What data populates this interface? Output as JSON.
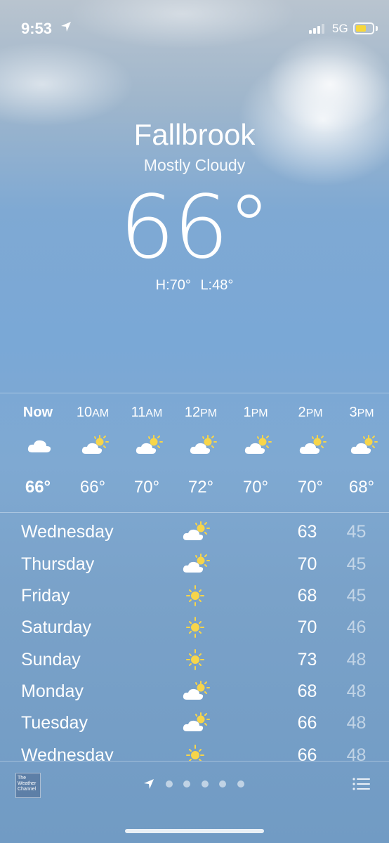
{
  "status_bar": {
    "time": "9:53",
    "network": "5G",
    "battery_color": "#f7d73b"
  },
  "location": {
    "city": "Fallbrook",
    "condition": "Mostly Cloudy",
    "temperature": "66°",
    "high": "H:70°",
    "low": "L:48°"
  },
  "hourly": [
    {
      "label": "Now",
      "icon": "cloud-icon",
      "temp": "66°"
    },
    {
      "label": "10AM",
      "icon": "partly-sunny-icon",
      "temp": "66°"
    },
    {
      "label": "11AM",
      "icon": "partly-sunny-icon",
      "temp": "70°"
    },
    {
      "label": "12PM",
      "icon": "partly-sunny-icon",
      "temp": "72°"
    },
    {
      "label": "1PM",
      "icon": "partly-sunny-icon",
      "temp": "70°"
    },
    {
      "label": "2PM",
      "icon": "partly-sunny-icon",
      "temp": "70°"
    },
    {
      "label": "3PM",
      "icon": "partly-sunny-icon",
      "temp": "68°"
    }
  ],
  "daily": [
    {
      "day": "Wednesday",
      "icon": "partly-sunny-icon",
      "high": "63",
      "low": "45"
    },
    {
      "day": "Thursday",
      "icon": "partly-sunny-icon",
      "high": "70",
      "low": "45"
    },
    {
      "day": "Friday",
      "icon": "sun-icon",
      "high": "68",
      "low": "45"
    },
    {
      "day": "Saturday",
      "icon": "sun-icon",
      "high": "70",
      "low": "46"
    },
    {
      "day": "Sunday",
      "icon": "sun-icon",
      "high": "73",
      "low": "48"
    },
    {
      "day": "Monday",
      "icon": "partly-sunny-icon",
      "high": "68",
      "low": "48"
    },
    {
      "day": "Tuesday",
      "icon": "partly-sunny-icon",
      "high": "66",
      "low": "48"
    },
    {
      "day": "Wednesday",
      "icon": "sun-icon",
      "high": "66",
      "low": "48"
    }
  ],
  "bottom_bar": {
    "logo_text": "The Weather Channel",
    "page_dots": 5
  },
  "colors": {
    "sun": "#f7d54a",
    "cloud": "#ffffff"
  }
}
